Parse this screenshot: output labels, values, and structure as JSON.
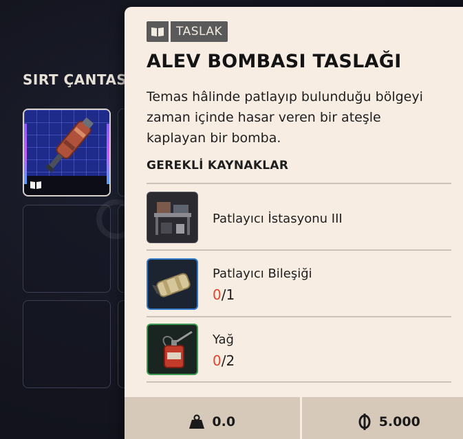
{
  "backpack": {
    "title": "SIRT ÇANTASI"
  },
  "tooltip": {
    "tag_label": "TASLAK",
    "title": "ALEV BOMBASI TASLAĞI",
    "description": "Temas hâlinde patlayıp bulunduğu bölgeyi zaman içinde hasar veren bir ateşle kaplayan bir bomba.",
    "requirements_heading": "GEREKLİ KAYNAKLAR",
    "resources": [
      {
        "name": "Patlayıcı İstasyonu III",
        "icon": "workbench-icon"
      },
      {
        "name": "Patlayıcı Bileşiği",
        "have": "0",
        "need": "/1",
        "icon": "explosive-compound-icon",
        "border_color": "#2f79c8"
      },
      {
        "name": "Yağ",
        "have": "0",
        "need": "/2",
        "icon": "oil-can-icon",
        "border_color": "#3a9a52"
      }
    ],
    "footer": {
      "weight": "0.0",
      "weight_icon": "weight-icon",
      "value": "5.000",
      "value_icon": "coin-icon"
    }
  },
  "colors": {
    "panel_bg": "#f7ede3",
    "have_count": "#e2452f",
    "tag_bg": "#5a5a5a"
  }
}
